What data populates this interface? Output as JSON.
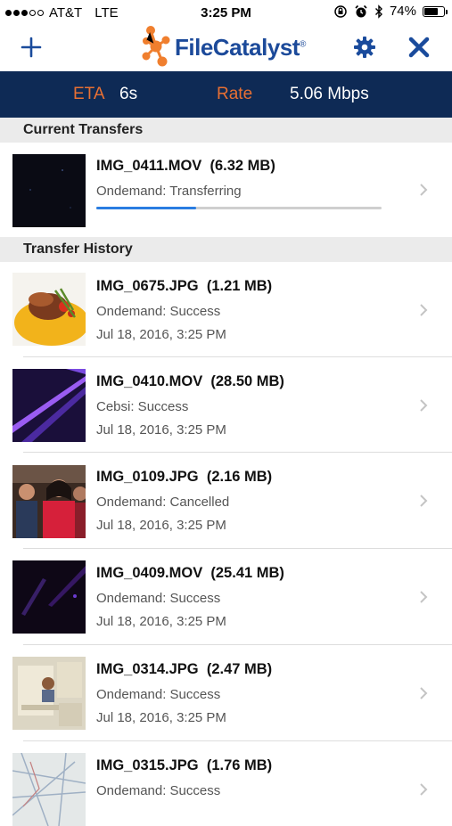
{
  "status_bar": {
    "carrier": "AT&T",
    "network": "LTE",
    "time": "3:25 PM",
    "battery": "74%",
    "battery_level": 0.74,
    "signal_bars_filled": 3,
    "signal_bars_total": 5
  },
  "header": {
    "add_icon": "plus-icon",
    "logo_text": "FileCatalyst",
    "logo_mark": "®",
    "settings_icon": "gear-icon",
    "close_icon": "close-icon",
    "accent_color": "#1c4a9a"
  },
  "rate_bar": {
    "eta_label": "ETA",
    "eta_value": "6s",
    "rate_label": "Rate",
    "rate_value": "5.06 Mbps",
    "label_color": "#e87033",
    "background": "#0e2a55"
  },
  "current": {
    "title": "Current Transfers",
    "items": [
      {
        "name": "IMG_0411.MOV",
        "size": "(6.32 MB)",
        "status": "Ondemand: Transferring",
        "progress": 0.35
      }
    ]
  },
  "history": {
    "title": "Transfer History",
    "items": [
      {
        "name": "IMG_0675.JPG",
        "size": "(1.21 MB)",
        "status": "Ondemand: Success",
        "date": "Jul 18, 2016, 3:25 PM"
      },
      {
        "name": "IMG_0410.MOV",
        "size": "(28.50 MB)",
        "status": "Cebsi: Success",
        "date": "Jul 18, 2016, 3:25 PM"
      },
      {
        "name": "IMG_0109.JPG",
        "size": "(2.16 MB)",
        "status": "Ondemand: Cancelled",
        "date": "Jul 18, 2016, 3:25 PM"
      },
      {
        "name": "IMG_0409.MOV",
        "size": "(25.41 MB)",
        "status": "Ondemand: Success",
        "date": "Jul 18, 2016, 3:25 PM"
      },
      {
        "name": "IMG_0314.JPG",
        "size": "(2.47 MB)",
        "status": "Ondemand: Success",
        "date": "Jul 18, 2016, 3:25 PM"
      },
      {
        "name": "IMG_0315.JPG",
        "size": "(1.76 MB)",
        "status": "Ondemand: Success",
        "date": ""
      }
    ]
  }
}
